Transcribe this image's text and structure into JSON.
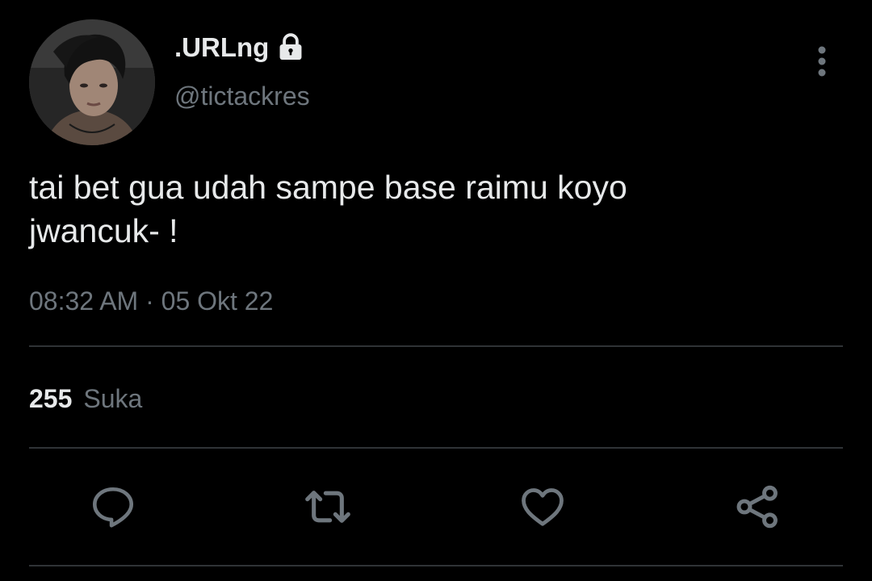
{
  "tweet": {
    "display_name": ".URLng",
    "handle": "@tictackres",
    "text": "tai bet gua udah sampe base raimu koyo\njwancuk- !",
    "meta": "08:32 AM · 05 Okt 22",
    "likes_count": "255",
    "likes_label": "Suka"
  },
  "icons": {
    "lock": "lock-icon",
    "more": "more-vertical-icon",
    "reply": "reply-icon",
    "retweet": "retweet-icon",
    "like": "heart-icon",
    "share": "share-icon"
  },
  "colors": {
    "background": "#000000",
    "primary_text": "#e7e9ea",
    "secondary_text": "#6e767d",
    "divider": "#2f3336"
  }
}
